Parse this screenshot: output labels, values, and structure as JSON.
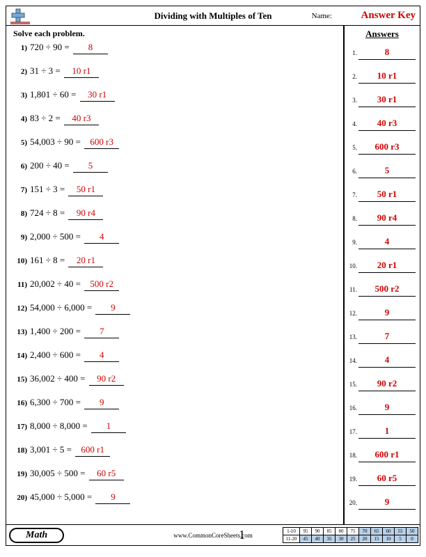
{
  "header": {
    "title": "Dividing with Multiples of Ten",
    "name_label": "Name:",
    "answer_key": "Answer Key"
  },
  "instruction": "Solve each problem.",
  "answers_header": "Answers",
  "problems": [
    {
      "n": "1)",
      "expr": "720 ÷ 90 = ",
      "ans": "8"
    },
    {
      "n": "2)",
      "expr": "31 ÷ 3 = ",
      "ans": "10 r1"
    },
    {
      "n": "3)",
      "expr": "1,801 ÷ 60 = ",
      "ans": "30 r1"
    },
    {
      "n": "4)",
      "expr": "83 ÷ 2 = ",
      "ans": "40 r3"
    },
    {
      "n": "5)",
      "expr": "54,003 ÷ 90 = ",
      "ans": "600 r3"
    },
    {
      "n": "6)",
      "expr": "200 ÷ 40 = ",
      "ans": "5"
    },
    {
      "n": "7)",
      "expr": "151 ÷ 3 = ",
      "ans": "50 r1"
    },
    {
      "n": "8)",
      "expr": "724 ÷ 8 = ",
      "ans": "90 r4"
    },
    {
      "n": "9)",
      "expr": "2,000 ÷ 500 = ",
      "ans": "4"
    },
    {
      "n": "10)",
      "expr": "161 ÷ 8 = ",
      "ans": "20 r1"
    },
    {
      "n": "11)",
      "expr": "20,002 ÷ 40 = ",
      "ans": "500 r2"
    },
    {
      "n": "12)",
      "expr": "54,000 ÷ 6,000 = ",
      "ans": "9"
    },
    {
      "n": "13)",
      "expr": "1,400 ÷ 200 = ",
      "ans": "7"
    },
    {
      "n": "14)",
      "expr": "2,400 ÷ 600 = ",
      "ans": "4"
    },
    {
      "n": "15)",
      "expr": "36,002 ÷ 400 = ",
      "ans": "90 r2"
    },
    {
      "n": "16)",
      "expr": "6,300 ÷ 700 = ",
      "ans": "9"
    },
    {
      "n": "17)",
      "expr": "8,000 ÷ 8,000 = ",
      "ans": "1"
    },
    {
      "n": "18)",
      "expr": "3,001 ÷ 5 = ",
      "ans": "600 r1"
    },
    {
      "n": "19)",
      "expr": "30,005 ÷ 500 = ",
      "ans": "60 r5"
    },
    {
      "n": "20)",
      "expr": "45,000 ÷ 5,000 = ",
      "ans": "9"
    }
  ],
  "answers": [
    {
      "n": "1.",
      "val": "8"
    },
    {
      "n": "2.",
      "val": "10 r1"
    },
    {
      "n": "3.",
      "val": "30 r1"
    },
    {
      "n": "4.",
      "val": "40 r3"
    },
    {
      "n": "5.",
      "val": "600 r3"
    },
    {
      "n": "6.",
      "val": "5"
    },
    {
      "n": "7.",
      "val": "50 r1"
    },
    {
      "n": "8.",
      "val": "90 r4"
    },
    {
      "n": "9.",
      "val": "4"
    },
    {
      "n": "10.",
      "val": "20 r1"
    },
    {
      "n": "11.",
      "val": "500 r2"
    },
    {
      "n": "12.",
      "val": "9"
    },
    {
      "n": "13.",
      "val": "7"
    },
    {
      "n": "14.",
      "val": "4"
    },
    {
      "n": "15.",
      "val": "90 r2"
    },
    {
      "n": "16.",
      "val": "9"
    },
    {
      "n": "17.",
      "val": "1"
    },
    {
      "n": "18.",
      "val": "600 r1"
    },
    {
      "n": "19.",
      "val": "60 r5"
    },
    {
      "n": "20.",
      "val": "9"
    }
  ],
  "footer": {
    "subject": "Math",
    "site": "www.CommonCoreSheets.com",
    "page": "1",
    "score_rows": [
      {
        "label": "1-10",
        "cells": [
          "95",
          "90",
          "85",
          "80",
          "75",
          "70",
          "65",
          "60",
          "55",
          "50"
        ],
        "shade_from": 5
      },
      {
        "label": "11-20",
        "cells": [
          "45",
          "40",
          "35",
          "30",
          "25",
          "20",
          "15",
          "10",
          "5",
          "0"
        ],
        "shade_from": 0
      }
    ]
  }
}
